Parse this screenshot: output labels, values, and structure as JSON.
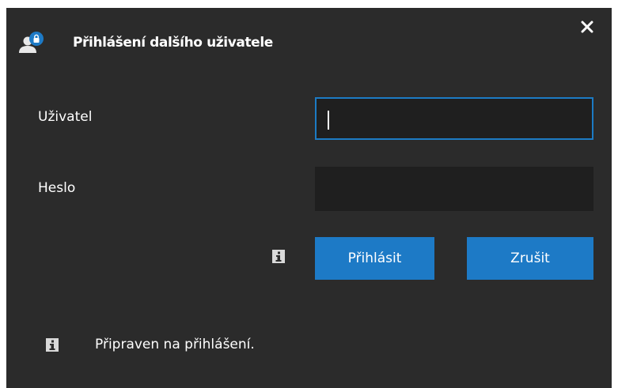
{
  "dialog": {
    "title": "Přihlášení dalšího uživatele",
    "close_icon": "close-icon",
    "title_icon": "user-lock-icon"
  },
  "form": {
    "user_label": "Uživatel",
    "user_value": "",
    "password_label": "Heslo",
    "password_value": ""
  },
  "buttons": {
    "login_label": "Přihlásit",
    "cancel_label": "Zrušit"
  },
  "status": {
    "text": "Připraven na přihlášení.",
    "icon": "info-icon"
  },
  "colors": {
    "background": "#2b2b2b",
    "input_background": "#1f1f1f",
    "accent": "#1d7ac6",
    "focus_border": "#1c7bc4"
  }
}
